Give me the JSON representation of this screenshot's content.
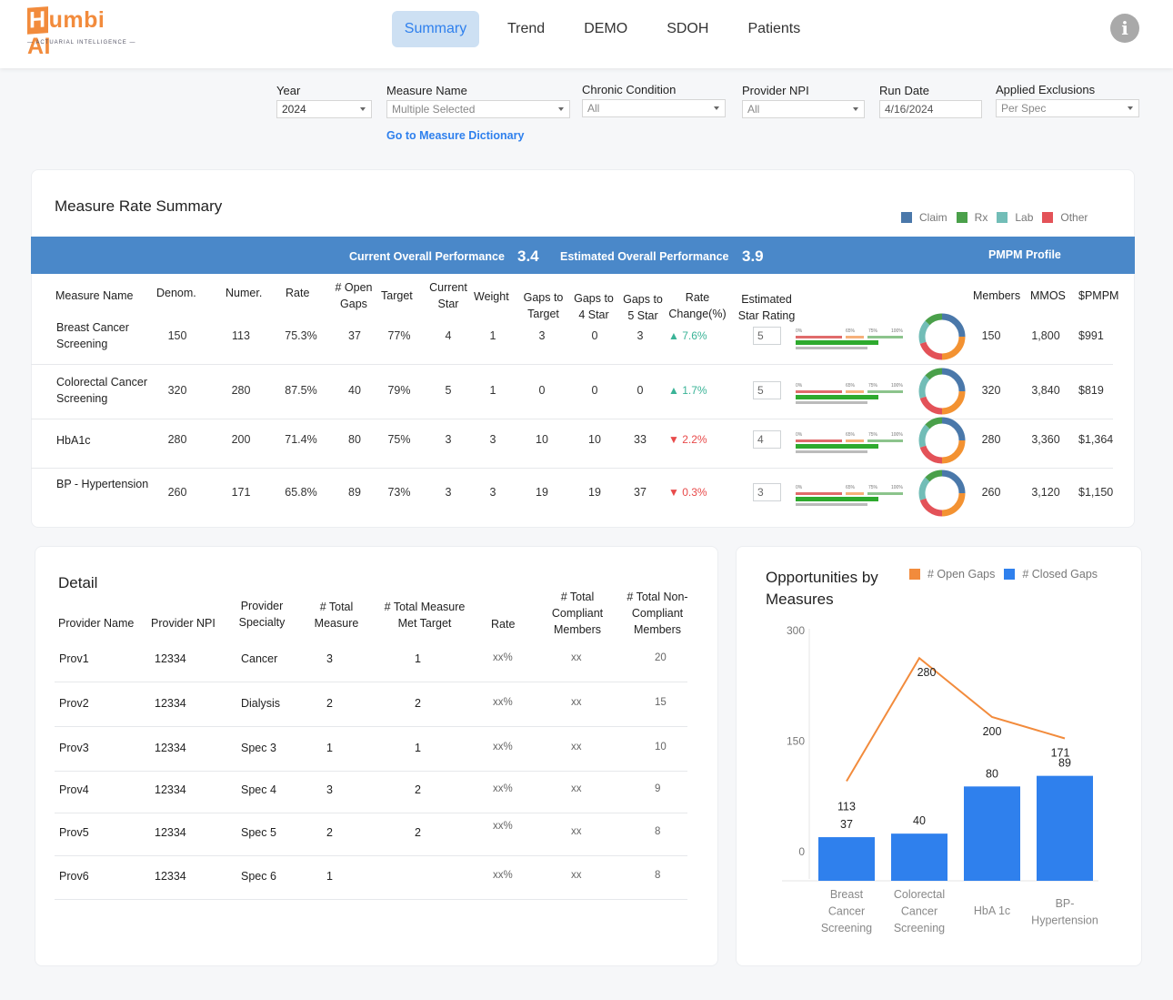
{
  "app": {
    "logo_text": "umbi AI",
    "logo_initial": "H",
    "logo_tagline": "— ACTUARIAL INTELLIGENCE —",
    "info_icon": "info-icon"
  },
  "nav": {
    "items": [
      {
        "label": "Summary",
        "active": true
      },
      {
        "label": "Trend",
        "active": false
      },
      {
        "label": "DEMO",
        "active": false
      },
      {
        "label": "SDOH",
        "active": false
      },
      {
        "label": "Patients",
        "active": false
      }
    ]
  },
  "filters": {
    "year": {
      "label": "Year",
      "value": "2024"
    },
    "measure_name": {
      "label": "Measure Name",
      "value": "Multiple Selected"
    },
    "chronic_condition": {
      "label": "Chronic Condition",
      "value": "All"
    },
    "provider_npi": {
      "label": "Provider NPI",
      "value": "All"
    },
    "run_date": {
      "label": "Run Date",
      "value": "4/16/2024"
    },
    "applied_exclusions": {
      "label": "Applied Exclusions",
      "value": "Per Spec"
    },
    "dictionary_link": "Go to Measure Dictionary"
  },
  "summary": {
    "title": "Measure Rate Summary",
    "legend": [
      {
        "label": "Claim",
        "color": "#4a78aa"
      },
      {
        "label": "Rx",
        "color": "#4aa04a"
      },
      {
        "label": "Lab",
        "color": "#72bdb7"
      },
      {
        "label": "Other",
        "color": "#e35258"
      }
    ],
    "current_label": "Current Overall Performance",
    "current_value": "3.4",
    "estimated_label": "Estimated Overall Performance",
    "estimated_value": "3.9",
    "pmpm_label": "PMPM Profile",
    "headers": {
      "measure": "Measure Name",
      "denom": "Denom.",
      "numer": "Numer.",
      "rate": "Rate",
      "open_gaps": "# Open Gaps",
      "target": "Target",
      "current_star": "Current Star",
      "weight": "Weight",
      "gaps_target": "Gaps to Target",
      "gaps_4": "Gaps to 4 Star",
      "gaps_5": "Gaps to 5 Star",
      "rate_change": "Rate Change(%)",
      "est_star": "Estimated Star Rating",
      "members": "Members",
      "mmos": "MMOS",
      "pmpm": "$PMPM"
    },
    "gauge_labels": [
      "0%",
      "65%",
      "75%",
      "100%"
    ],
    "rows": [
      {
        "measure": "Breast Cancer Screening",
        "denom": "150",
        "numer": "113",
        "rate": "75.3%",
        "open_gaps": "37",
        "target": "77%",
        "current_star": "4",
        "weight": "1",
        "gaps_target": "3",
        "gaps_4": "0",
        "gaps_5": "3",
        "rate_change": "7.6%",
        "direction": "up",
        "est_star": "5",
        "members": "150",
        "mmos": "1,800",
        "pmpm": "$991"
      },
      {
        "measure": "Colorectal Cancer Screening",
        "denom": "320",
        "numer": "280",
        "rate": "87.5%",
        "open_gaps": "40",
        "target": "79%",
        "current_star": "5",
        "weight": "1",
        "gaps_target": "0",
        "gaps_4": "0",
        "gaps_5": "0",
        "rate_change": "1.7%",
        "direction": "up",
        "est_star": "5",
        "members": "320",
        "mmos": "3,840",
        "pmpm": "$819"
      },
      {
        "measure": "HbA1c",
        "denom": "280",
        "numer": "200",
        "rate": "71.4%",
        "open_gaps": "80",
        "target": "75%",
        "current_star": "3",
        "weight": "3",
        "gaps_target": "10",
        "gaps_4": "10",
        "gaps_5": "33",
        "rate_change": "2.2%",
        "direction": "down",
        "est_star": "4",
        "members": "280",
        "mmos": "3,360",
        "pmpm": "$1,364"
      },
      {
        "measure": "BP - Hypertension",
        "denom": "260",
        "numer": "171",
        "rate": "65.8%",
        "open_gaps": "89",
        "target": "73%",
        "current_star": "3",
        "weight": "3",
        "gaps_target": "19",
        "gaps_4": "19",
        "gaps_5": "37",
        "rate_change": "0.3%",
        "direction": "down",
        "est_star": "3",
        "members": "260",
        "mmos": "3,120",
        "pmpm": "$1,150"
      }
    ]
  },
  "detail": {
    "title": "Detail",
    "headers": {
      "name": "Provider Name",
      "npi": "Provider NPI",
      "specialty": "Provider Specialty",
      "total_measure": "# Total Measure",
      "met_target": "# Total Measure Met Target",
      "rate": "Rate",
      "compliant": "# Total Compliant Members",
      "non_compliant": "# Total Non-Compliant Members"
    },
    "rows": [
      {
        "name": "Prov1",
        "npi": "12334",
        "specialty": "Cancer",
        "total_measure": "3",
        "met_target": "1",
        "rate": "xx%",
        "compliant": "xx",
        "non_compliant": "20"
      },
      {
        "name": "Prov2",
        "npi": "12334",
        "specialty": "Dialysis",
        "total_measure": "2",
        "met_target": "2",
        "rate": "xx%",
        "compliant": "xx",
        "non_compliant": "15"
      },
      {
        "name": "Prov3",
        "npi": "12334",
        "specialty": "Spec 3",
        "total_measure": "1",
        "met_target": "1",
        "rate": "xx%",
        "compliant": "xx",
        "non_compliant": "10"
      },
      {
        "name": "Prov4",
        "npi": "12334",
        "specialty": "Spec 4",
        "total_measure": "3",
        "met_target": "2",
        "rate": "xx%",
        "compliant": "xx",
        "non_compliant": "9"
      },
      {
        "name": "Prov5",
        "npi": "12334",
        "specialty": "Spec 5",
        "total_measure": "2",
        "met_target": "2",
        "rate": "xx%",
        "compliant": "xx",
        "non_compliant": "8"
      },
      {
        "name": "Prov6",
        "npi": "12334",
        "specialty": "Spec 6",
        "total_measure": "1",
        "met_target": "",
        "rate": "xx%",
        "compliant": "xx",
        "non_compliant": "8"
      }
    ]
  },
  "chart_data": {
    "type": "bar",
    "title": "Opportunities by Measures",
    "categories": [
      "Breast Cancer Screening",
      "Colorectal Cancer Screening",
      "HbA 1c",
      "BP-Hypertension"
    ],
    "series": [
      {
        "name": "# Open Gaps",
        "type": "line",
        "color": "#f28b3c",
        "values": [
          113,
          280,
          200,
          171
        ]
      },
      {
        "name": "# Closed Gaps",
        "type": "bar",
        "color": "#2f80ed",
        "values": [
          37,
          40,
          80,
          89
        ]
      }
    ],
    "yticks": [
      0,
      150,
      300
    ],
    "ylim": [
      0,
      300
    ],
    "legend": "top-right",
    "grid": false,
    "xlabel": "",
    "ylabel": ""
  }
}
